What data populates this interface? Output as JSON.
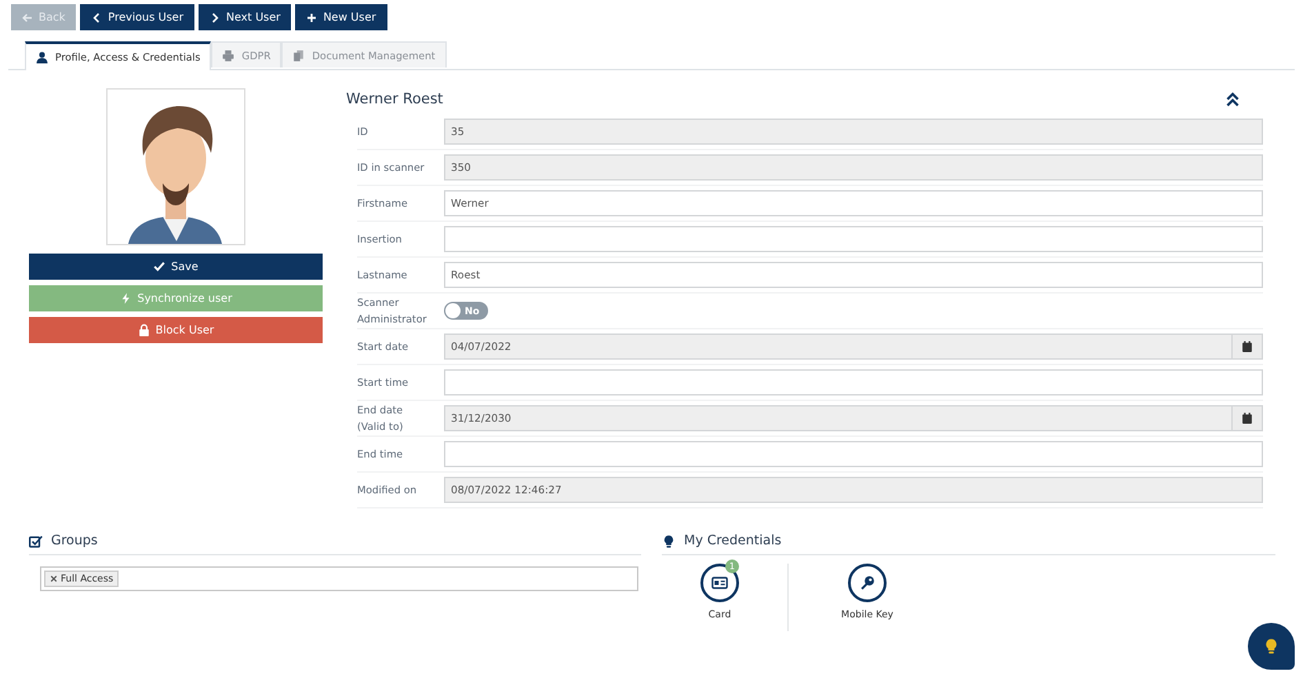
{
  "toolbar": [
    {
      "label": "Back",
      "disabled": true
    },
    {
      "label": "Previous User",
      "disabled": false
    },
    {
      "label": "Next User",
      "disabled": false
    },
    {
      "label": "New User",
      "disabled": false
    }
  ],
  "tabs": [
    {
      "label": "Profile, Access & Credentials",
      "selected": true
    },
    {
      "label": "GDPR",
      "selected": false
    },
    {
      "label": "Document Management",
      "selected": false
    }
  ],
  "actions": [
    {
      "label": "Save",
      "kind": "primary"
    },
    {
      "label": "Synchronize user",
      "kind": "success"
    },
    {
      "label": "Block User",
      "kind": "danger"
    }
  ],
  "user": {
    "name": "Werner Roest"
  },
  "fields": [
    {
      "kind": "text",
      "label": "ID",
      "value": "35",
      "disabled": true
    },
    {
      "kind": "text",
      "label": "ID in scanner",
      "value": "350",
      "disabled": true
    },
    {
      "kind": "text",
      "label": "Firstname",
      "value": "Werner",
      "disabled": false
    },
    {
      "kind": "text",
      "label": "Insertion",
      "disabled": false
    },
    {
      "kind": "text",
      "label": "Lastname",
      "value": "Roest",
      "disabled": false
    },
    {
      "kind": "toggle",
      "label": "Scanner Administrator",
      "on": false,
      "state_label": "No"
    },
    {
      "kind": "date",
      "label": "Start date",
      "value": "04/07/2022",
      "disabled": true
    },
    {
      "kind": "text",
      "label": "Start time",
      "disabled": false
    },
    {
      "kind": "date",
      "label": "End date (Valid to)",
      "value": "31/12/2030",
      "disabled": true
    },
    {
      "kind": "text",
      "label": "End time",
      "disabled": false
    },
    {
      "kind": "text",
      "label": "Modified on",
      "value": "08/07/2022 12:46:27",
      "disabled": true
    }
  ],
  "groups": {
    "title": "Groups",
    "tags": [
      "Full Access"
    ]
  },
  "credentials": {
    "title": "My Credentials",
    "items": [
      {
        "label": "Card",
        "badge": "1"
      },
      {
        "label": "Mobile Key"
      }
    ]
  }
}
